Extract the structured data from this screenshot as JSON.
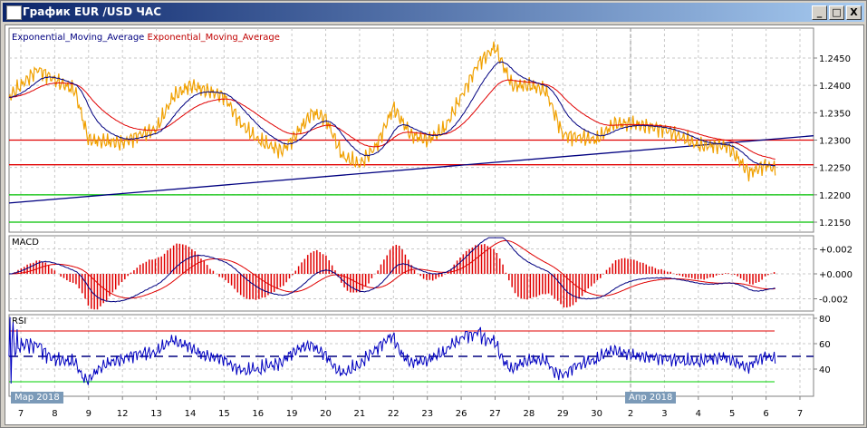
{
  "window": {
    "title": "График EUR /USD  ЧАС",
    "buttons": {
      "minimize": "_",
      "maximize": "□",
      "close": "X"
    }
  },
  "legend": {
    "ema_fast": "Exponential_Moving_Average",
    "ema_slow": "Exponential_Moving_Average"
  },
  "panels": {
    "macd": "MACD",
    "rsi": "RSI"
  },
  "month_tags": {
    "march": "Мар 2018",
    "april": "Апр 2018"
  },
  "colors": {
    "price": "#f0a000",
    "ema_fast": "#000080",
    "ema_slow": "#e00000",
    "level_red": "#e00000",
    "level_green": "#00c000",
    "trend": "#000080"
  },
  "chart_data": [
    {
      "type": "line",
      "title": "EUR/USD hourly",
      "x_labels": [
        "7",
        "8",
        "9",
        "12",
        "13",
        "14",
        "15",
        "16",
        "19",
        "20",
        "21",
        "22",
        "23",
        "26",
        "27",
        "28",
        "29",
        "30",
        "2",
        "3",
        "4",
        "5",
        "6",
        "7"
      ],
      "y_ticks": [
        "1.2450",
        "1.2400",
        "1.2350",
        "1.2300",
        "1.2250",
        "1.2200",
        "1.2150"
      ],
      "ylim": [
        1.213,
        1.2485
      ],
      "price_keypoints": [
        [
          0,
          1.24
        ],
        [
          0.5,
          1.243
        ],
        [
          1,
          1.241
        ],
        [
          1.6,
          1.239
        ],
        [
          2,
          1.23
        ],
        [
          3,
          1.2295
        ],
        [
          3.5,
          1.231
        ],
        [
          4,
          1.232
        ],
        [
          4.5,
          1.238
        ],
        [
          5,
          1.24
        ],
        [
          6,
          1.238
        ],
        [
          6.5,
          1.233
        ],
        [
          7,
          1.23
        ],
        [
          7.7,
          1.228
        ],
        [
          8,
          1.23
        ],
        [
          8.6,
          1.235
        ],
        [
          9,
          1.234
        ],
        [
          9.5,
          1.227
        ],
        [
          10,
          1.2255
        ],
        [
          10.5,
          1.229
        ],
        [
          11,
          1.236
        ],
        [
          11.5,
          1.231
        ],
        [
          12,
          1.23
        ],
        [
          12.5,
          1.232
        ],
        [
          13,
          1.238
        ],
        [
          13.5,
          1.244
        ],
        [
          14,
          1.247
        ],
        [
          14.5,
          1.24
        ],
        [
          15,
          1.24
        ],
        [
          15.5,
          1.239
        ],
        [
          16,
          1.231
        ],
        [
          17,
          1.23
        ],
        [
          17.5,
          1.233
        ],
        [
          18,
          1.233
        ],
        [
          19,
          1.232
        ],
        [
          20,
          1.229
        ],
        [
          20.8,
          1.229
        ],
        [
          21,
          1.228
        ],
        [
          21.5,
          1.224
        ],
        [
          22,
          1.2255
        ],
        [
          22.3,
          1.2245
        ]
      ],
      "horizontal_levels": [
        {
          "value": 1.23,
          "color": "red"
        },
        {
          "value": 1.2255,
          "color": "red"
        },
        {
          "value": 1.22,
          "color": "green"
        },
        {
          "value": 1.215,
          "color": "green"
        }
      ],
      "trendline": [
        [
          -0.4,
          1.2185
        ],
        [
          23.5,
          1.2308
        ]
      ]
    },
    {
      "type": "line",
      "title": "MACD",
      "y_ticks": [
        "+0.002",
        "+0.000",
        "-0.002"
      ],
      "ylim": [
        -0.003,
        0.003
      ]
    },
    {
      "type": "line",
      "title": "RSI",
      "y_ticks": [
        "80",
        "60",
        "40"
      ],
      "levels": [
        70,
        50,
        30
      ],
      "ylim": [
        21,
        82
      ]
    }
  ]
}
